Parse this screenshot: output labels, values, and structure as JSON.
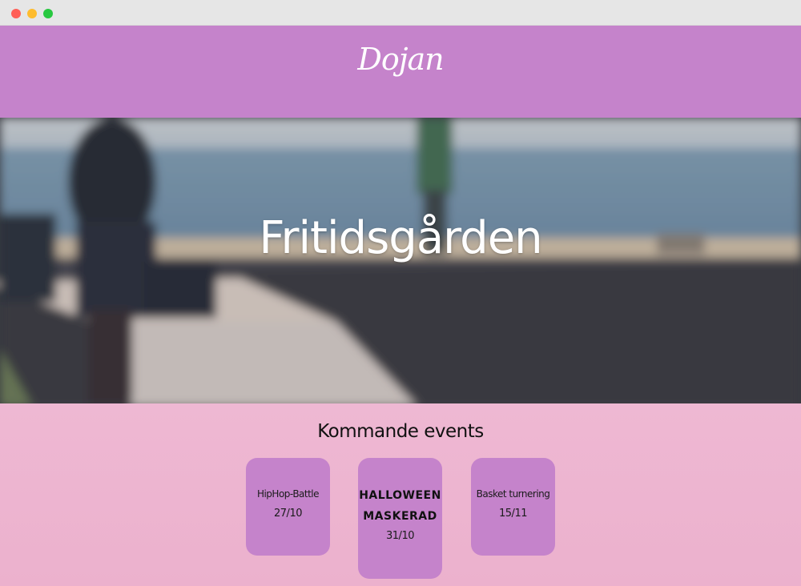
{
  "window": {
    "controls": [
      "close",
      "minimize",
      "zoom"
    ]
  },
  "header": {
    "logo": "Dojan",
    "background": "#c583cb"
  },
  "hero": {
    "title": "Fritidsgården"
  },
  "events": {
    "heading": "Kommande events",
    "items": [
      {
        "name": "HipHop-Battle",
        "date": "27/10"
      },
      {
        "name_line1": "HALLOWEEN",
        "name_line2": "MASKERAD",
        "date": "31/10"
      },
      {
        "name": "Basket turnering",
        "date": "15/11"
      }
    ],
    "card_color": "#c583cb",
    "background": "#eeb7d2"
  }
}
